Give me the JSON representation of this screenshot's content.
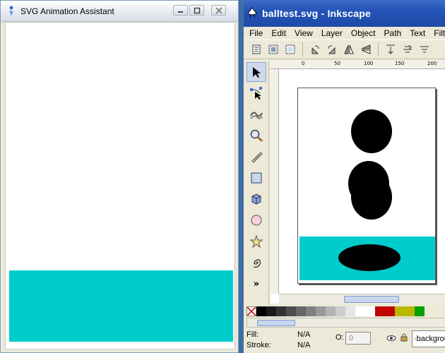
{
  "left_window": {
    "title": "SVG Animation Assistant",
    "ground_color": "#00cccc"
  },
  "right_window": {
    "title": "balltest.svg - Inkscape",
    "menu": [
      "File",
      "Edit",
      "View",
      "Layer",
      "Object",
      "Path",
      "Text",
      "Filte"
    ],
    "ruler_ticks": [
      "0",
      "50",
      "100",
      "150",
      "200"
    ],
    "palette_colors": [
      "#000000",
      "#1a1a1a",
      "#333333",
      "#4d4d4d",
      "#666666",
      "#808080",
      "#999999",
      "#b3b3b3",
      "#cccccc",
      "#e6e6e6",
      "#ffffff",
      "#ffffff",
      "#c00000",
      "#c00000",
      "#b8b800",
      "#b8b800",
      "#00a000"
    ],
    "status": {
      "fill_label": "Fill:",
      "fill_value": "N/A",
      "stroke_label": "Stroke:",
      "stroke_value": "N/A",
      "opacity_label": "O:",
      "opacity_value": "0",
      "layer_value": "·backgrou"
    },
    "more_tools_glyph": "»",
    "canvas_ground_color": "#00cccc"
  }
}
